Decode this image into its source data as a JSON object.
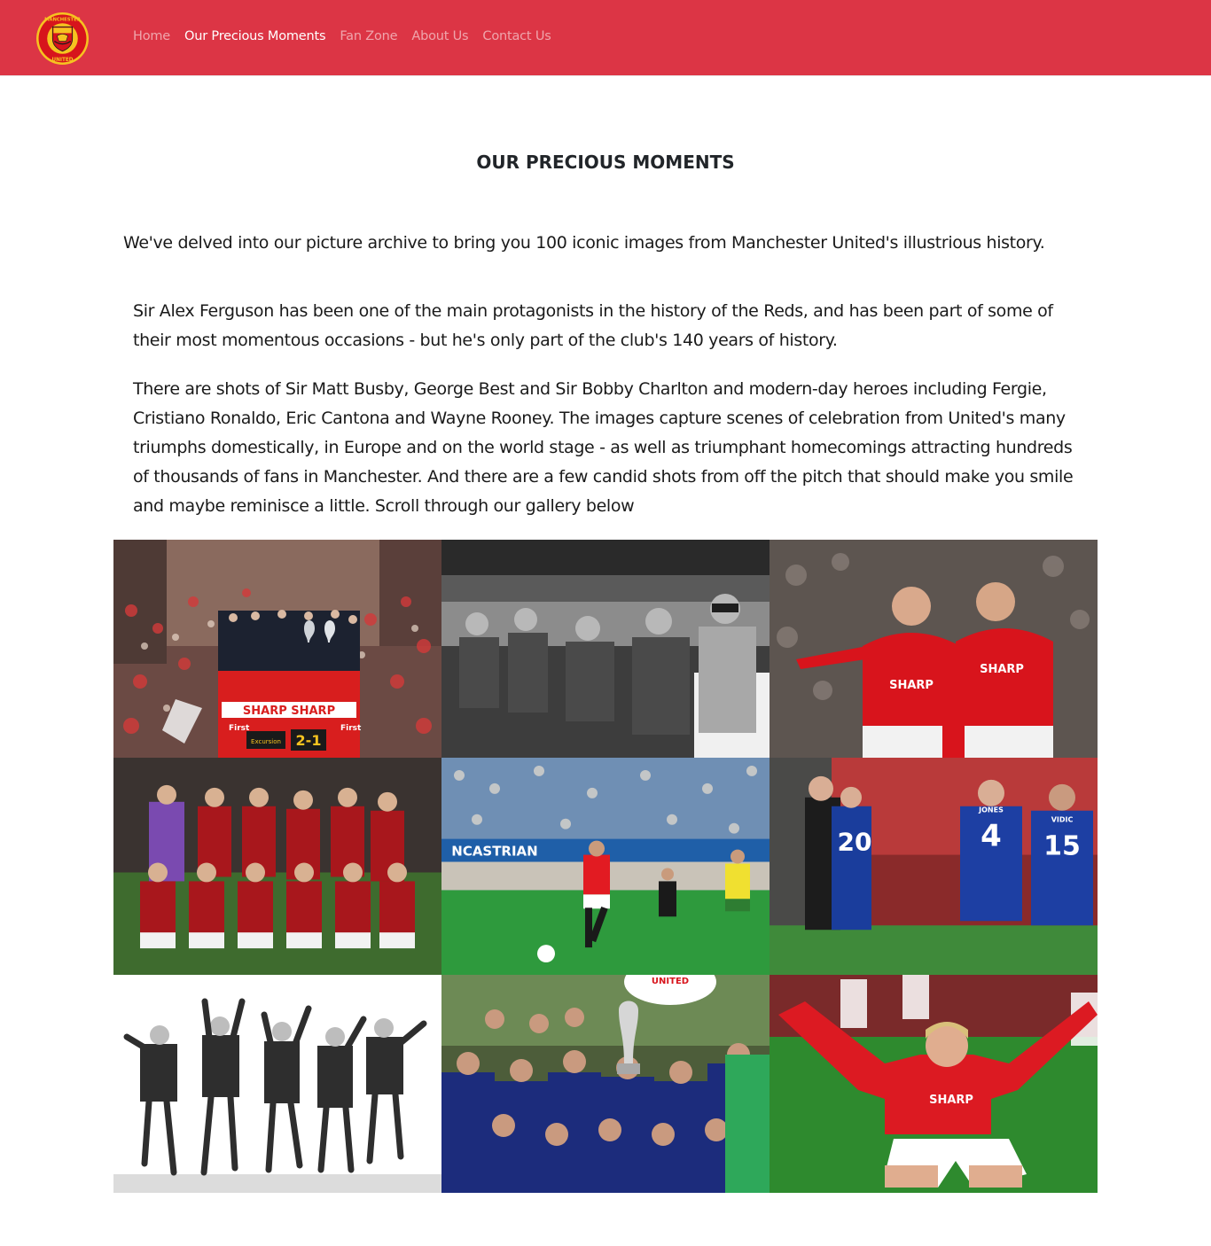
{
  "brand": {
    "logo_icon": "manchester-united-crest-icon",
    "logo_text_top": "MANCHESTER",
    "logo_text_bottom": "UNITED",
    "nav_color": "#dc3545"
  },
  "nav": {
    "items": [
      {
        "label": "Home",
        "active": false
      },
      {
        "label": "Our Precious Moments",
        "active": true
      },
      {
        "label": "Fan Zone",
        "active": false
      },
      {
        "label": "About Us",
        "active": false
      },
      {
        "label": "Contact Us",
        "active": false
      }
    ]
  },
  "main": {
    "title": "OUR PRECIOUS MOMENTS",
    "intro": "We've delved into our picture archive to bring you 100 iconic images from Manchester United's illustrious history.",
    "paragraph_2": "Sir Alex Ferguson has been one of the main protagonists in the history of the Reds, and has been part of some of their most momentous occasions - but he's only part of the club's 140 years of history.",
    "paragraph_3": "There are shots of Sir Matt Busby, George Best and Sir Bobby Charlton and modern-day heroes including Fergie, Cristiano Ronaldo, Eric Cantona and Wayne Rooney. The images capture scenes of celebration from United's many triumphs domestically, in Europe and on the world stage - as well as triumphant homecomings attracting hundreds of thousands of fans in Manchester. And there are a few candid shots from off the pitch that should make you smile and maybe reminisce a little. Scroll through our gallery below"
  },
  "gallery": {
    "photos": [
      {
        "icon": "trophy-parade-bus-photo",
        "bus_sign": "SHARP SHARP",
        "bus_score": "2-1",
        "bus_left": "Excursion",
        "bus_brand": "First"
      },
      {
        "icon": "managers-dugout-bw-photo"
      },
      {
        "icon": "players-celebrating-photo",
        "shirt_text": "SHARP"
      },
      {
        "icon": "team-squad-photo"
      },
      {
        "icon": "player-running-match-photo",
        "stand_text": "NCASTRIAN"
      },
      {
        "icon": "manager-hugging-player-photo",
        "shirt_numbers": [
          "4",
          "15"
        ],
        "shirt_names": [
          "JONES",
          "VIDIC"
        ],
        "back_number": "20"
      },
      {
        "icon": "players-jumping-bw-photo"
      },
      {
        "icon": "europa-league-trophy-celebration-photo",
        "banner_text": "UNITED"
      },
      {
        "icon": "player-knee-slide-photo",
        "shirt_text": "SHARP"
      }
    ]
  }
}
